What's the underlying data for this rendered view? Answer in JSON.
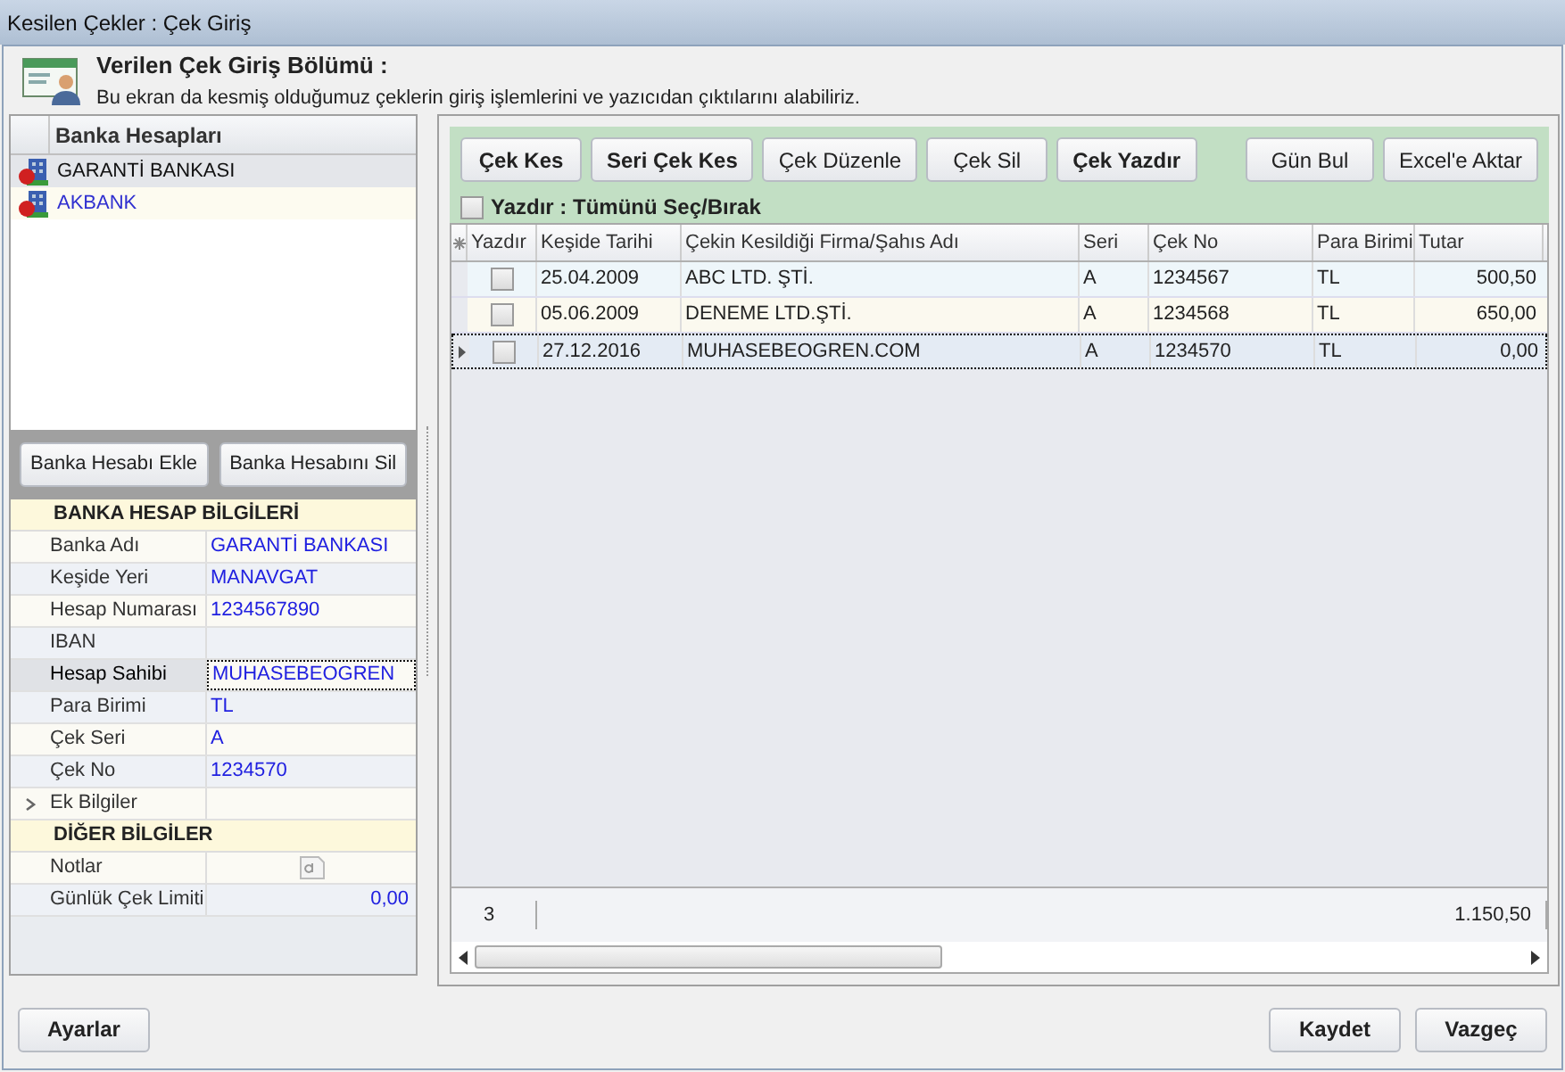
{
  "window": {
    "title": "Kesilen Çekler : Çek Giriş"
  },
  "header": {
    "title": "Verilen Çek Giriş Bölümü :",
    "description": "Bu ekran da kesmiş olduğumuz çeklerin giriş işlemlerini ve yazıcıdan çıktılarını alabiliriz."
  },
  "bank_accounts": {
    "column": "Banka Hesapları",
    "items": [
      {
        "name": "GARANTİ BANKASI",
        "selected": true
      },
      {
        "name": "AKBANK",
        "selected": false
      }
    ]
  },
  "account_buttons": [
    "Banka Hesabı Ekle",
    "Banka Hesabını Sil"
  ],
  "properties": [
    {
      "title": "BANKA HESAP BİLGİLERİ",
      "rows": [
        {
          "label": "Banka Adı",
          "value": "GARANTİ BANKASI",
          "focused": false
        },
        {
          "label": "Keşide Yeri",
          "value": "MANAVGAT",
          "focused": false
        },
        {
          "label": "Hesap Numarası",
          "value": "1234567890",
          "focused": false
        },
        {
          "label": "IBAN",
          "focused": false
        },
        {
          "label": "Hesap Sahibi",
          "value": "MUHASEBEOGREN",
          "focused": true
        },
        {
          "label": "Para Birimi",
          "value": "TL",
          "focused": false
        },
        {
          "label": "Çek Seri",
          "value": "A",
          "focused": false
        },
        {
          "label": "Çek No",
          "value": "1234570",
          "focused": false
        },
        {
          "label": "Ek Bilgiler",
          "kind": "expandable",
          "expanded": false,
          "focused": false
        }
      ]
    },
    {
      "title": "DİĞER BİLGİLER",
      "rows": [
        {
          "label": "Notlar",
          "kind": "memo",
          "focused": false
        },
        {
          "label": "Günlük Çek Limiti",
          "value": "0,00",
          "kind": "number",
          "focused": false
        }
      ]
    }
  ],
  "toolbar": {
    "buttons": [
      {
        "label": "Çek Kes",
        "bold": true
      },
      {
        "label": "Seri Çek Kes",
        "bold": true
      },
      {
        "label": "Çek Düzenle",
        "bold": false
      },
      {
        "label": "Çek Sil",
        "bold": false
      },
      {
        "label": "Çek Yazdır",
        "bold": true
      }
    ],
    "right_buttons": [
      "Gün Bul",
      "Excel'e Aktar"
    ],
    "select_all": {
      "label": "Yazdır : Tümünü Seç/Bırak",
      "checked": false
    }
  },
  "table": {
    "columns": [
      "Yazdır",
      "Keşide Tarihi",
      "Çekin Kesildiği Firma/Şahıs Adı",
      "Seri",
      "Çek No",
      "Para Birimi",
      "Tutar"
    ],
    "rows": [
      {
        "print": false,
        "date": "25.04.2009",
        "name": "ABC LTD. ŞTİ.",
        "series": "A",
        "number": "1234567",
        "currency": "TL",
        "amount": "500,50",
        "selected": false
      },
      {
        "print": false,
        "date": "05.06.2009",
        "name": "DENEME LTD.ŞTİ.",
        "series": "A",
        "number": "1234568",
        "currency": "TL",
        "amount": "650,00",
        "selected": false
      },
      {
        "print": false,
        "date": "27.12.2016",
        "name": "MUHASEBEOGREN.COM",
        "series": "A",
        "number": "1234570",
        "currency": "TL",
        "amount": "0,00",
        "selected": true
      }
    ],
    "footer": {
      "count": "3",
      "total": "1.150,50"
    }
  },
  "left_buttons": [
    "Ayarlar"
  ],
  "dialog_buttons": [
    "Kaydet",
    "Vazgeç"
  ]
}
